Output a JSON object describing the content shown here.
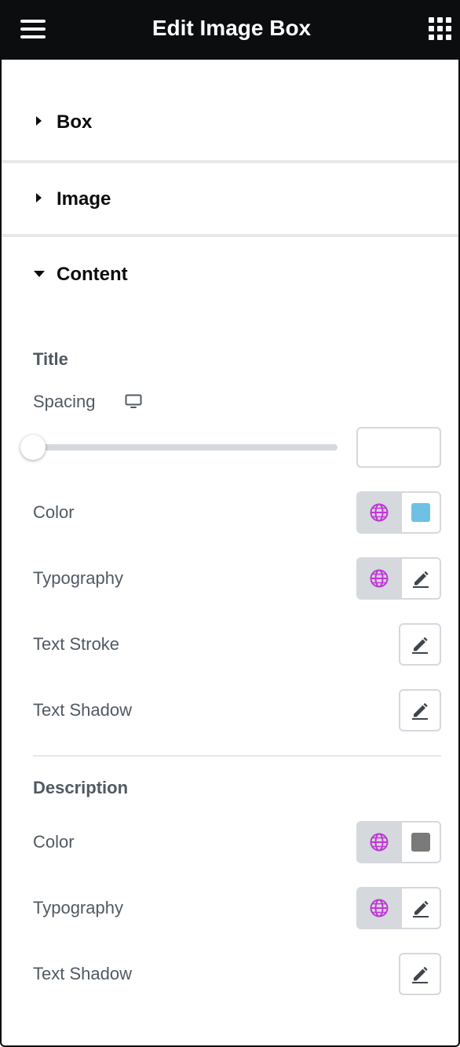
{
  "header": {
    "title": "Edit Image Box",
    "menu_icon": "hamburger-menu-icon",
    "apps_icon": "grid-apps-icon"
  },
  "sections": [
    {
      "label": "Box",
      "expanded": false
    },
    {
      "label": "Image",
      "expanded": false
    },
    {
      "label": "Content",
      "expanded": true
    }
  ],
  "title_group": {
    "heading": "Title",
    "spacing": {
      "label": "Spacing",
      "device_icon": "desktop-monitor-icon",
      "value": "",
      "slider_position": 0
    },
    "color": {
      "label": "Color",
      "swatch": "#6ec1e4"
    },
    "typography": {
      "label": "Typography"
    },
    "text_stroke": {
      "label": "Text Stroke"
    },
    "text_shadow": {
      "label": "Text Shadow"
    }
  },
  "description_group": {
    "heading": "Description",
    "color": {
      "label": "Color",
      "swatch": "#7a7a7a"
    },
    "typography": {
      "label": "Typography"
    },
    "text_shadow": {
      "label": "Text Shadow"
    }
  },
  "colors": {
    "header_bg": "#0c0d0e",
    "global_icon": "#c036d8",
    "border": "#d5d8dc"
  }
}
